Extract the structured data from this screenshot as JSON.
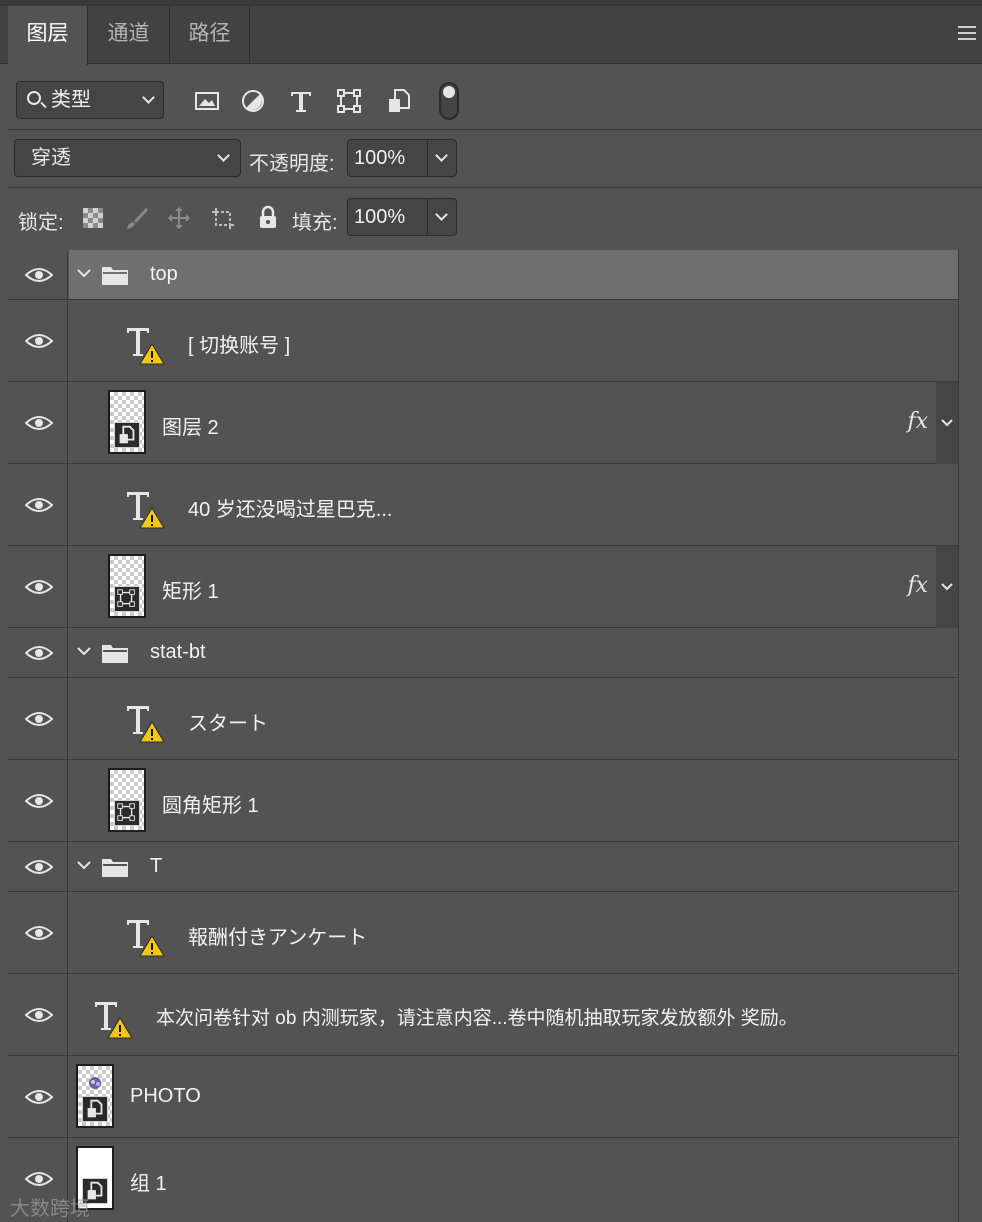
{
  "tabs": [
    {
      "label": "图层",
      "active": true
    },
    {
      "label": "通道",
      "active": false
    },
    {
      "label": "路径",
      "active": false
    }
  ],
  "filter": {
    "kind_label": "类型",
    "icons": [
      "image-filter-icon",
      "adjustment-filter-icon",
      "type-filter-icon",
      "shape-filter-icon",
      "smart-object-filter-icon"
    ]
  },
  "blend": {
    "mode": "穿透",
    "opacity_label": "不透明度:",
    "opacity_value": "100%"
  },
  "lock": {
    "label": "锁定:",
    "fill_label": "填充:",
    "fill_value": "100%"
  },
  "layers": [
    {
      "name": "top",
      "kind": "group"
    },
    {
      "name": "[ 切换账号 ]",
      "kind": "text"
    },
    {
      "name": "图层 2",
      "kind": "smart",
      "fx": "fx"
    },
    {
      "name": "40 岁还没喝过星巴克...",
      "kind": "text"
    },
    {
      "name": "矩形 1",
      "kind": "shape",
      "fx": "fx"
    },
    {
      "name": "stat-bt",
      "kind": "group"
    },
    {
      "name": "スタート",
      "kind": "text"
    },
    {
      "name": "圆角矩形 1",
      "kind": "shape"
    },
    {
      "name": "T",
      "kind": "group"
    },
    {
      "name": "報酬付きアンケート",
      "kind": "text"
    },
    {
      "name": "本次问卷针对 ob 内测玩家，请注意内容...卷中随机抽取玩家发放额外 奖励。",
      "kind": "text"
    },
    {
      "name": "PHOTO",
      "kind": "smart"
    },
    {
      "name": "组 1",
      "kind": "smart"
    }
  ],
  "watermark": "大数跨境",
  "colors": {
    "panel": "#535353",
    "selected": "#6f6f6f",
    "warning": "#f5c518"
  }
}
